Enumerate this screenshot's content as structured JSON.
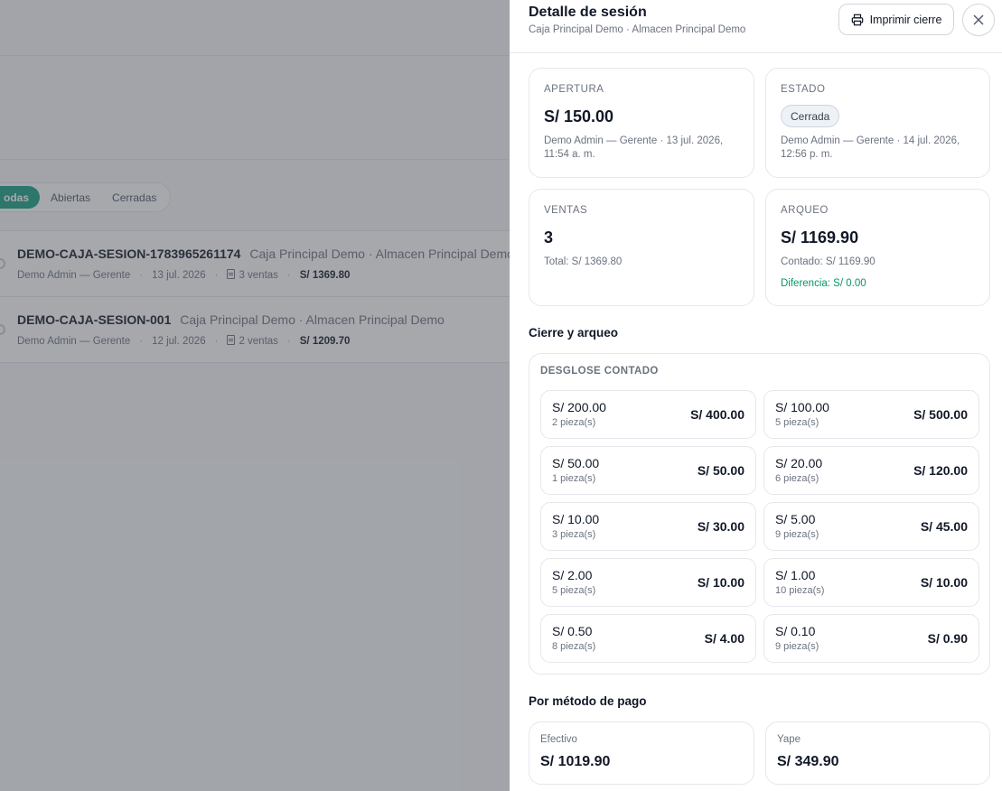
{
  "background": {
    "filters": [
      "odas",
      "Abiertas",
      "Cerradas"
    ],
    "sessions": [
      {
        "code": "DEMO-CAJA-SESION-1783965261174",
        "location": "Caja Principal Demo · Almacen Principal Demo",
        "user": "Demo Admin — Gerente",
        "date": "13 jul. 2026",
        "sales": "3 ventas",
        "total": "S/ 1369.80"
      },
      {
        "code": "DEMO-CAJA-SESION-001",
        "location": "Caja Principal Demo · Almacen Principal Demo",
        "user": "Demo Admin — Gerente",
        "date": "12 jul. 2026",
        "sales": "2 ventas",
        "total": "S/ 1209.70"
      }
    ]
  },
  "drawer": {
    "title": "Detalle de sesión",
    "subtitle": "Caja Principal Demo · Almacen Principal Demo",
    "print_label": "Imprimir cierre",
    "close_icon": "close-icon"
  },
  "summary": {
    "apertura": {
      "label": "APERTURA",
      "amount": "S/ 150.00",
      "detail": "Demo Admin — Gerente · 13 jul. 2026, 11:54 a. m."
    },
    "estado": {
      "label": "ESTADO",
      "badge": "Cerrada",
      "detail": "Demo Admin — Gerente · 14 jul. 2026, 12:56 p. m."
    },
    "ventas": {
      "label": "VENTAS",
      "count": "3",
      "total": "Total: S/ 1369.80"
    },
    "arqueo": {
      "label": "ARQUEO",
      "amount": "S/ 1169.90",
      "contado": "Contado: S/ 1169.90",
      "diferencia": "Diferencia: S/ 0.00"
    }
  },
  "cierre": {
    "title": "Cierre y arqueo",
    "desglose_title": "DESGLOSE CONTADO",
    "denominations": [
      {
        "value": "S/ 200.00",
        "pieces": "2 pieza(s)",
        "total": "S/ 400.00"
      },
      {
        "value": "S/ 100.00",
        "pieces": "5 pieza(s)",
        "total": "S/ 500.00"
      },
      {
        "value": "S/ 50.00",
        "pieces": "1 pieza(s)",
        "total": "S/ 50.00"
      },
      {
        "value": "S/ 20.00",
        "pieces": "6 pieza(s)",
        "total": "S/ 120.00"
      },
      {
        "value": "S/ 10.00",
        "pieces": "3 pieza(s)",
        "total": "S/ 30.00"
      },
      {
        "value": "S/ 5.00",
        "pieces": "9 pieza(s)",
        "total": "S/ 45.00"
      },
      {
        "value": "S/ 2.00",
        "pieces": "5 pieza(s)",
        "total": "S/ 10.00"
      },
      {
        "value": "S/ 1.00",
        "pieces": "10 pieza(s)",
        "total": "S/ 10.00"
      },
      {
        "value": "S/ 0.50",
        "pieces": "8 pieza(s)",
        "total": "S/ 4.00"
      },
      {
        "value": "S/ 0.10",
        "pieces": "9 pieza(s)",
        "total": "S/ 0.90"
      }
    ]
  },
  "payments": {
    "title": "Por método de pago",
    "methods": [
      {
        "label": "Efectivo",
        "amount": "S/ 1019.90"
      },
      {
        "label": "Yape",
        "amount": "S/ 349.90"
      }
    ]
  },
  "colors": {
    "accent": "#16a085",
    "positive": "#059669",
    "overlay": "#464a52"
  }
}
